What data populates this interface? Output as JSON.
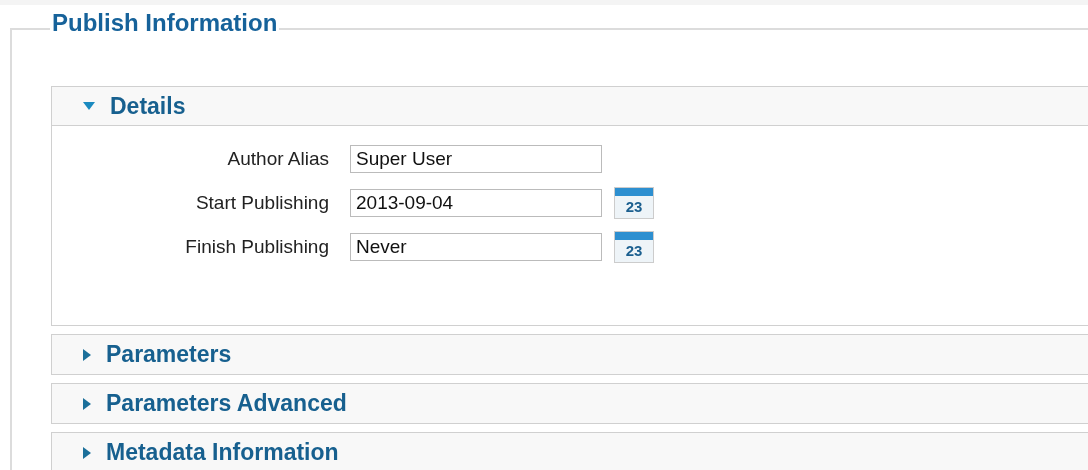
{
  "fieldset": {
    "legend": "Publish Information"
  },
  "panels": [
    {
      "title": "Details",
      "expanded": true,
      "fields": [
        {
          "kind": "text",
          "label": "Author Alias",
          "value": "Super User"
        },
        {
          "kind": "date",
          "label": "Start Publishing",
          "value": "2013-09-04",
          "calendar_day": "23"
        },
        {
          "kind": "date",
          "label": "Finish Publishing",
          "value": "Never",
          "calendar_day": "23"
        }
      ]
    },
    {
      "title": "Parameters",
      "expanded": false
    },
    {
      "title": "Parameters Advanced",
      "expanded": false
    },
    {
      "title": "Metadata Information",
      "expanded": false
    }
  ]
}
